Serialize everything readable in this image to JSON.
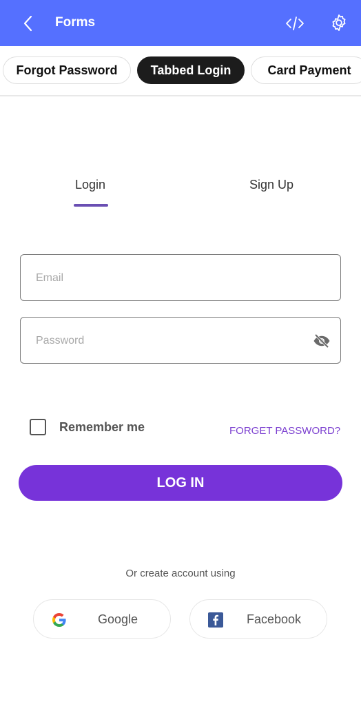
{
  "appbar": {
    "title": "Forms",
    "back_icon": "chevron-left-icon",
    "code_icon": "code-icon",
    "settings_icon": "gear-icon",
    "color": "#5570ff"
  },
  "chips": [
    {
      "label": "Forgot Password",
      "active": false
    },
    {
      "label": "Tabbed Login",
      "active": true
    },
    {
      "label": "Card Payment",
      "active": false
    }
  ],
  "tabs": [
    {
      "label": "Login",
      "active": true
    },
    {
      "label": "Sign Up",
      "active": false
    }
  ],
  "form": {
    "email": {
      "placeholder": "Email",
      "value": ""
    },
    "password": {
      "placeholder": "Password",
      "value": "",
      "toggle_icon": "eye-off-icon"
    },
    "remember_label": "Remember me",
    "remember_checked": false,
    "forget_label": "FORGET PASSWORD?",
    "login_label": "LOG IN",
    "accent": "#7733d9"
  },
  "social": {
    "prompt": "Or create account using",
    "buttons": [
      {
        "label": "Google",
        "icon": "google-icon"
      },
      {
        "label": "Facebook",
        "icon": "facebook-icon"
      }
    ]
  }
}
